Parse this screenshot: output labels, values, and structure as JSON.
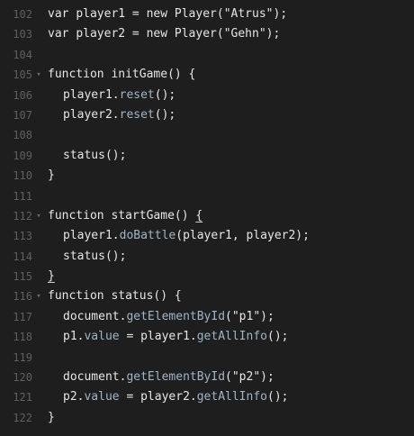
{
  "editor": {
    "lines": [
      {
        "num": "102",
        "fold": false,
        "indent": 0,
        "tokens": [
          {
            "t": "kw",
            "v": "var "
          },
          {
            "t": "id",
            "v": "player1 = "
          },
          {
            "t": "kw",
            "v": "new "
          },
          {
            "t": "id",
            "v": "Player("
          },
          {
            "t": "str",
            "v": "\"Atrus\""
          },
          {
            "t": "p",
            "v": ");"
          }
        ]
      },
      {
        "num": "103",
        "fold": false,
        "indent": 0,
        "tokens": [
          {
            "t": "kw",
            "v": "var "
          },
          {
            "t": "id",
            "v": "player2 = "
          },
          {
            "t": "kw",
            "v": "new "
          },
          {
            "t": "id",
            "v": "Player("
          },
          {
            "t": "str",
            "v": "\"Gehn\""
          },
          {
            "t": "p",
            "v": ");"
          }
        ]
      },
      {
        "num": "104",
        "fold": false,
        "indent": 0,
        "tokens": []
      },
      {
        "num": "105",
        "fold": true,
        "indent": 0,
        "tokens": [
          {
            "t": "kw",
            "v": "function "
          },
          {
            "t": "id",
            "v": "initGame() {"
          }
        ]
      },
      {
        "num": "106",
        "fold": false,
        "indent": 1,
        "tokens": [
          {
            "t": "id",
            "v": "player1."
          },
          {
            "t": "m",
            "v": "reset"
          },
          {
            "t": "p",
            "v": "();"
          }
        ]
      },
      {
        "num": "107",
        "fold": false,
        "indent": 1,
        "tokens": [
          {
            "t": "id",
            "v": "player2."
          },
          {
            "t": "m",
            "v": "reset"
          },
          {
            "t": "p",
            "v": "();"
          }
        ]
      },
      {
        "num": "108",
        "fold": false,
        "indent": 0,
        "tokens": []
      },
      {
        "num": "109",
        "fold": false,
        "indent": 1,
        "tokens": [
          {
            "t": "id",
            "v": "status();"
          }
        ]
      },
      {
        "num": "110",
        "fold": false,
        "indent": 0,
        "tokens": [
          {
            "t": "p",
            "v": "}"
          }
        ]
      },
      {
        "num": "111",
        "fold": false,
        "indent": 0,
        "tokens": []
      },
      {
        "num": "112",
        "fold": true,
        "indent": 0,
        "tokens": [
          {
            "t": "kw",
            "v": "function "
          },
          {
            "t": "id",
            "v": "startGame() "
          },
          {
            "t": "p",
            "v": "{",
            "match": true
          }
        ]
      },
      {
        "num": "113",
        "fold": false,
        "indent": 1,
        "tokens": [
          {
            "t": "id",
            "v": "player1."
          },
          {
            "t": "m",
            "v": "doBattle"
          },
          {
            "t": "p",
            "v": "(player1, player2);"
          }
        ]
      },
      {
        "num": "114",
        "fold": false,
        "indent": 1,
        "tokens": [
          {
            "t": "id",
            "v": "status();"
          }
        ]
      },
      {
        "num": "115",
        "fold": false,
        "indent": 0,
        "tokens": [
          {
            "t": "p",
            "v": "}",
            "match": true
          }
        ]
      },
      {
        "num": "116",
        "fold": true,
        "indent": 0,
        "tokens": [
          {
            "t": "kw",
            "v": "function "
          },
          {
            "t": "id",
            "v": "status() {"
          }
        ]
      },
      {
        "num": "117",
        "fold": false,
        "indent": 1,
        "tokens": [
          {
            "t": "id",
            "v": "document."
          },
          {
            "t": "m",
            "v": "getElementById"
          },
          {
            "t": "p",
            "v": "("
          },
          {
            "t": "str",
            "v": "\"p1\""
          },
          {
            "t": "p",
            "v": ");"
          }
        ]
      },
      {
        "num": "118",
        "fold": false,
        "indent": 1,
        "tokens": [
          {
            "t": "id",
            "v": "p1."
          },
          {
            "t": "m",
            "v": "value"
          },
          {
            "t": "id",
            "v": " = player1."
          },
          {
            "t": "m",
            "v": "getAllInfo"
          },
          {
            "t": "p",
            "v": "();"
          }
        ]
      },
      {
        "num": "119",
        "fold": false,
        "indent": 0,
        "tokens": []
      },
      {
        "num": "120",
        "fold": false,
        "indent": 1,
        "tokens": [
          {
            "t": "id",
            "v": "document."
          },
          {
            "t": "m",
            "v": "getElementById"
          },
          {
            "t": "p",
            "v": "("
          },
          {
            "t": "str",
            "v": "\"p2\""
          },
          {
            "t": "p",
            "v": ");"
          }
        ]
      },
      {
        "num": "121",
        "fold": false,
        "indent": 1,
        "tokens": [
          {
            "t": "id",
            "v": "p2."
          },
          {
            "t": "m",
            "v": "value"
          },
          {
            "t": "id",
            "v": " = player2."
          },
          {
            "t": "m",
            "v": "getAllInfo"
          },
          {
            "t": "p",
            "v": "();"
          }
        ]
      },
      {
        "num": "122",
        "fold": false,
        "indent": 0,
        "tokens": [
          {
            "t": "p",
            "v": "}"
          }
        ]
      }
    ],
    "fold_icon": "chevron-down-icon"
  }
}
